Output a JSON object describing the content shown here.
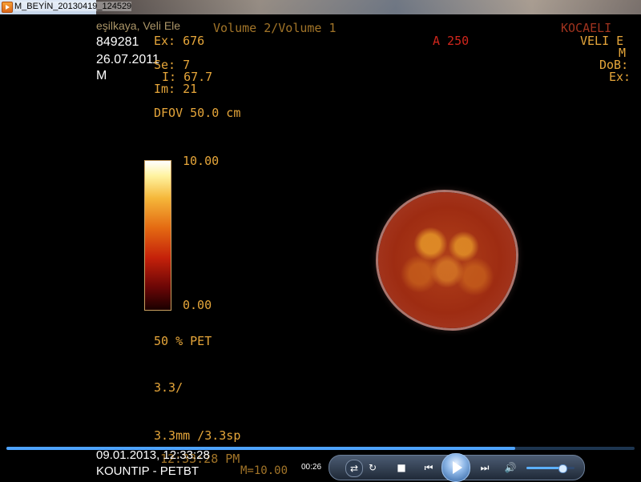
{
  "window": {
    "title": "M_BEYİN_20130419_124529",
    "icon": "media-player-icon"
  },
  "patient_overlay": {
    "id": "849281",
    "date": "26.07.2011",
    "sex": "M",
    "name_partial": "eşilkaya, Veli Ele",
    "bottom_datetime": "09.01.2013, 12:33:28",
    "bottom_label": "KOUNTIP - PETBT"
  },
  "scan_overlay": {
    "ex": "Ex: 676",
    "volume": "Volume 2/Volume 1",
    "se": "Se: 7",
    "i": "I: 67.7",
    "im": "Im: 21",
    "dfov": "DFOV 50.0 cm",
    "a_value": "A 250",
    "site": "KOCAELI",
    "right_name": "VELI E",
    "right_sex": "M",
    "right_dob": "DoB:",
    "right_ex": "Ex:",
    "colorbar_max": "10.00",
    "colorbar_min": "0.00",
    "blend": "50 % PET",
    "thickness_short": "3.3/",
    "thickness": "3.3mm /3.3sp",
    "time": "12:33:28 PM",
    "window_level": "M=10.00"
  },
  "player": {
    "elapsed": "00:26",
    "progress": 0.81,
    "volume": 0.75,
    "colors": {
      "progress": "#4ea3ff",
      "controls_bg": "#202a38"
    }
  }
}
